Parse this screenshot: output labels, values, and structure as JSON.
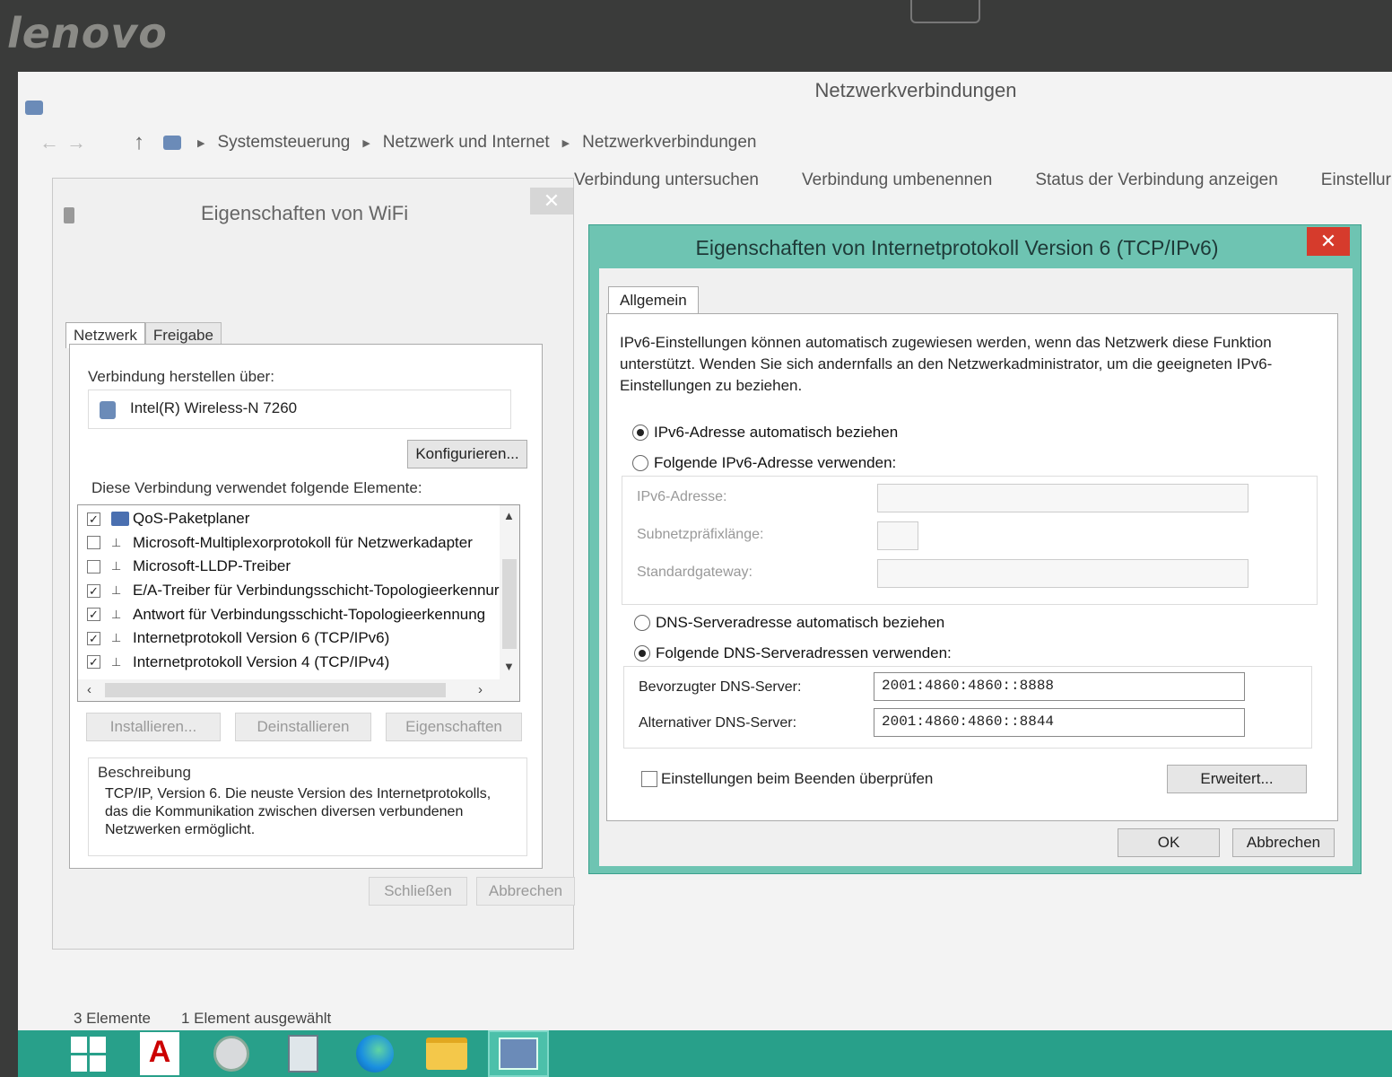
{
  "bezel": {
    "brand": "lenovo"
  },
  "explorer": {
    "title": "Netzwerkverbindungen",
    "breadcrumb": [
      "Systemsteuerung",
      "Netzwerk und Internet",
      "Netzwerkverbindungen"
    ],
    "commands": [
      "Verbindung untersuchen",
      "Verbindung umbenennen",
      "Status der Verbindung anzeigen",
      "Einstellur"
    ],
    "status": {
      "items": "3 Elemente",
      "selected": "1 Element ausgewählt"
    }
  },
  "wifi_dialog": {
    "title": "Eigenschaften von WiFi",
    "close": "✕",
    "tabs": [
      "Netzwerk",
      "Freigabe"
    ],
    "connect_via_label": "Verbindung herstellen über:",
    "adapter": "Intel(R) Wireless-N 7260",
    "configure_button": "Konfigurieren...",
    "elements_label": "Diese Verbindung verwendet folgende Elemente:",
    "components": [
      {
        "checked": "✓",
        "label": "QoS-Paketplaner"
      },
      {
        "checked": "",
        "label": "Microsoft-Multiplexorprotokoll für Netzwerkadapter"
      },
      {
        "checked": "",
        "label": "Microsoft-LLDP-Treiber"
      },
      {
        "checked": "✓",
        "label": "E/A-Treiber für Verbindungsschicht-Topologieerkennur"
      },
      {
        "checked": "✓",
        "label": "Antwort für Verbindungsschicht-Topologieerkennung"
      },
      {
        "checked": "✓",
        "label": "Internetprotokoll Version 6 (TCP/IPv6)"
      },
      {
        "checked": "✓",
        "label": "Internetprotokoll Version 4 (TCP/IPv4)"
      }
    ],
    "install_button": "Installieren...",
    "uninstall_button": "Deinstallieren",
    "properties_button": "Eigenschaften",
    "description_label": "Beschreibung",
    "description_text": "TCP/IP, Version 6. Die neuste Version des Internetprotokolls, das die Kommunikation zwischen diversen verbundenen Netzwerken ermöglicht.",
    "close_button": "Schließen",
    "cancel_button": "Abbrechen"
  },
  "ipv6_dialog": {
    "title": "Eigenschaften von Internetprotokoll Version 6 (TCP/IPv6)",
    "close": "✕",
    "tab": "Allgemein",
    "intro": "IPv6-Einstellungen können automatisch zugewiesen werden, wenn das Netzwerk diese Funktion unterstützt. Wenden Sie sich andernfalls an den Netzwerkadministrator, um die geeigneten IPv6-Einstellungen zu beziehen.",
    "auto_address": "IPv6-Adresse automatisch beziehen",
    "manual_address": "Folgende IPv6-Adresse verwenden:",
    "ipv6_address_label": "IPv6-Adresse:",
    "prefix_label": "Subnetzpräfixlänge:",
    "gateway_label": "Standardgateway:",
    "dns_auto": "DNS-Serveradresse automatisch beziehen",
    "dns_manual": "Folgende DNS-Serveradressen verwenden:",
    "preferred_dns_label": "Bevorzugter DNS-Server:",
    "preferred_dns": "2001:4860:4860::8888",
    "alternate_dns_label": "Alternativer DNS-Server:",
    "alternate_dns": "2001:4860:4860::8844",
    "validate_label": "Einstellungen beim Beenden überprüfen",
    "advanced_button": "Erweitert...",
    "ok_button": "OK",
    "cancel_button": "Abbrechen"
  },
  "taskbar": {
    "apps": [
      "windows-start",
      "adobe",
      "snipping-tool",
      "calculator",
      "edge",
      "file-explorer",
      "network-connections"
    ],
    "adobe_label": "Adobe"
  },
  "colors": {
    "taskbar": "#28a08a",
    "dialog_frame": "#6ec4b2",
    "close_red": "#d63b2c"
  }
}
